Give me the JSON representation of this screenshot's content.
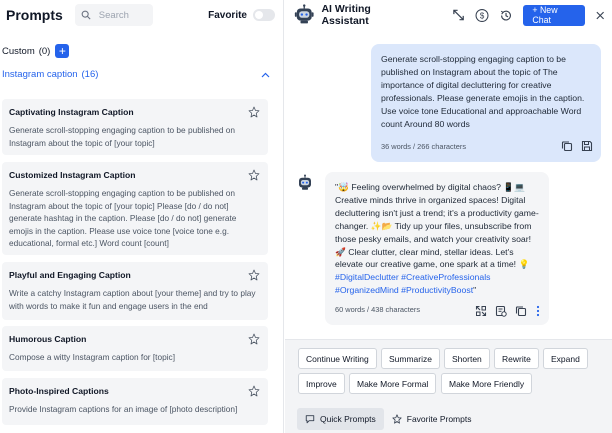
{
  "left": {
    "title": "Prompts",
    "search_placeholder": "Search",
    "favorite_label": "Favorite",
    "custom_label": "Custom",
    "custom_count": "(0)",
    "add_symbol": "+",
    "category_label": "Instagram caption",
    "category_count": "(16)",
    "cards": [
      {
        "title": "Captivating Instagram Caption",
        "desc": "Generate scroll-stopping engaging caption to be published on Instagram about the topic of [your topic]"
      },
      {
        "title": "Customized Instagram Caption",
        "desc": "Generate scroll-stopping engaging caption to be published on Instagram about the topic of [your topic] Please [do / do not] generate hashtag in the caption. Please [do / do not] generate emojis in the caption. Please use voice tone [voice tone e.g. educational, formal etc.] Word count [count]"
      },
      {
        "title": "Playful and Engaging Caption",
        "desc": "Write a catchy Instagram caption about [your theme] and try to play with words to make it fun and engage users in the end"
      },
      {
        "title": "Humorous Caption",
        "desc": "Compose a witty Instagram caption for [topic]"
      },
      {
        "title": "Photo-Inspired Captions",
        "desc": "Provide Instagram captions for an image of [photo description]"
      }
    ]
  },
  "right": {
    "title": "AI Writing Assistant",
    "new_chat_label": "+ New Chat",
    "user_message": "Generate scroll-stopping engaging caption to be published on Instagram about the topic of The importance of digital decluttering for creative professionals. Please generate emojis in the caption. Use voice tone Educational and approachable Word count Around 80 words",
    "user_meta": "36 words / 266 characters",
    "ai_message_body": "\"🤯 Feeling overwhelmed by digital chaos? 📱💻 Creative minds thrive in organized spaces! Digital decluttering isn't just a trend; it's a productivity game-changer. ✨📂 Tidy up your files, unsubscribe from those pesky emails, and watch your creativity soar! 🚀 Clear clutter, clear mind, stellar ideas. Let's elevate our creative game, one spark at a time! 💡",
    "ai_hashtags": "#DigitalDeclutter #CreativeProfessionals #OrganizedMind #ProductivityBoost",
    "ai_close_quote": "\"",
    "ai_meta": "60 words / 438 characters",
    "actions": [
      "Continue Writing",
      "Summarize",
      "Shorten",
      "Rewrite",
      "Expand",
      "Improve",
      "Make More Formal",
      "Make More Friendly"
    ],
    "tabs": [
      "Quick Prompts",
      "Favorite Prompts"
    ]
  },
  "colors": {
    "accent": "#2563eb",
    "user_bubble": "#dbe7fb",
    "ai_bubble": "#f4f5f7"
  }
}
